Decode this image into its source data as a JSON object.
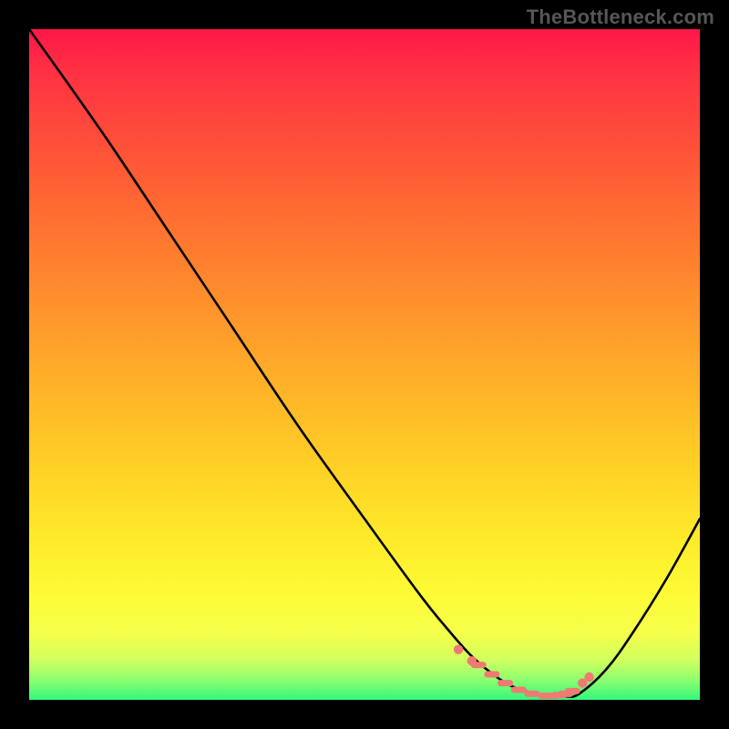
{
  "watermark": "TheBottleneck.com",
  "chart_data": {
    "type": "line",
    "title": "",
    "xlabel": "",
    "ylabel": "",
    "xlim": [
      0,
      100
    ],
    "ylim": [
      0,
      100
    ],
    "grid": false,
    "legend": false,
    "series": [
      {
        "name": "curve",
        "x": [
          0,
          5,
          12,
          20,
          30,
          40,
          50,
          58,
          62,
          66,
          70,
          73,
          76,
          78,
          80,
          82,
          86,
          90,
          95,
          100
        ],
        "y": [
          100,
          93,
          83,
          71,
          56,
          41,
          27,
          16,
          11,
          6.5,
          3.2,
          1.6,
          0.8,
          0.5,
          0.5,
          0.9,
          4.5,
          10,
          18,
          27
        ]
      }
    ],
    "markers": {
      "name": "flat-region-markers",
      "color": "#ef7a73",
      "points_x": [
        64,
        66,
        67,
        69,
        71,
        73,
        75,
        77,
        78,
        79,
        80,
        81,
        82.5,
        83.5
      ],
      "points_y": [
        7.5,
        5.8,
        5.2,
        3.8,
        2.5,
        1.5,
        0.9,
        0.6,
        0.6,
        0.7,
        0.9,
        1.3,
        2.5,
        3.4
      ]
    },
    "gradient_stops": [
      {
        "pct": 0,
        "color": "#ff1649"
      },
      {
        "pct": 18,
        "color": "#ff5238"
      },
      {
        "pct": 42,
        "color": "#ff942c"
      },
      {
        "pct": 66,
        "color": "#ffd226"
      },
      {
        "pct": 84,
        "color": "#fdfb35"
      },
      {
        "pct": 97,
        "color": "#8dff6f"
      },
      {
        "pct": 100,
        "color": "#34f77a"
      }
    ]
  }
}
